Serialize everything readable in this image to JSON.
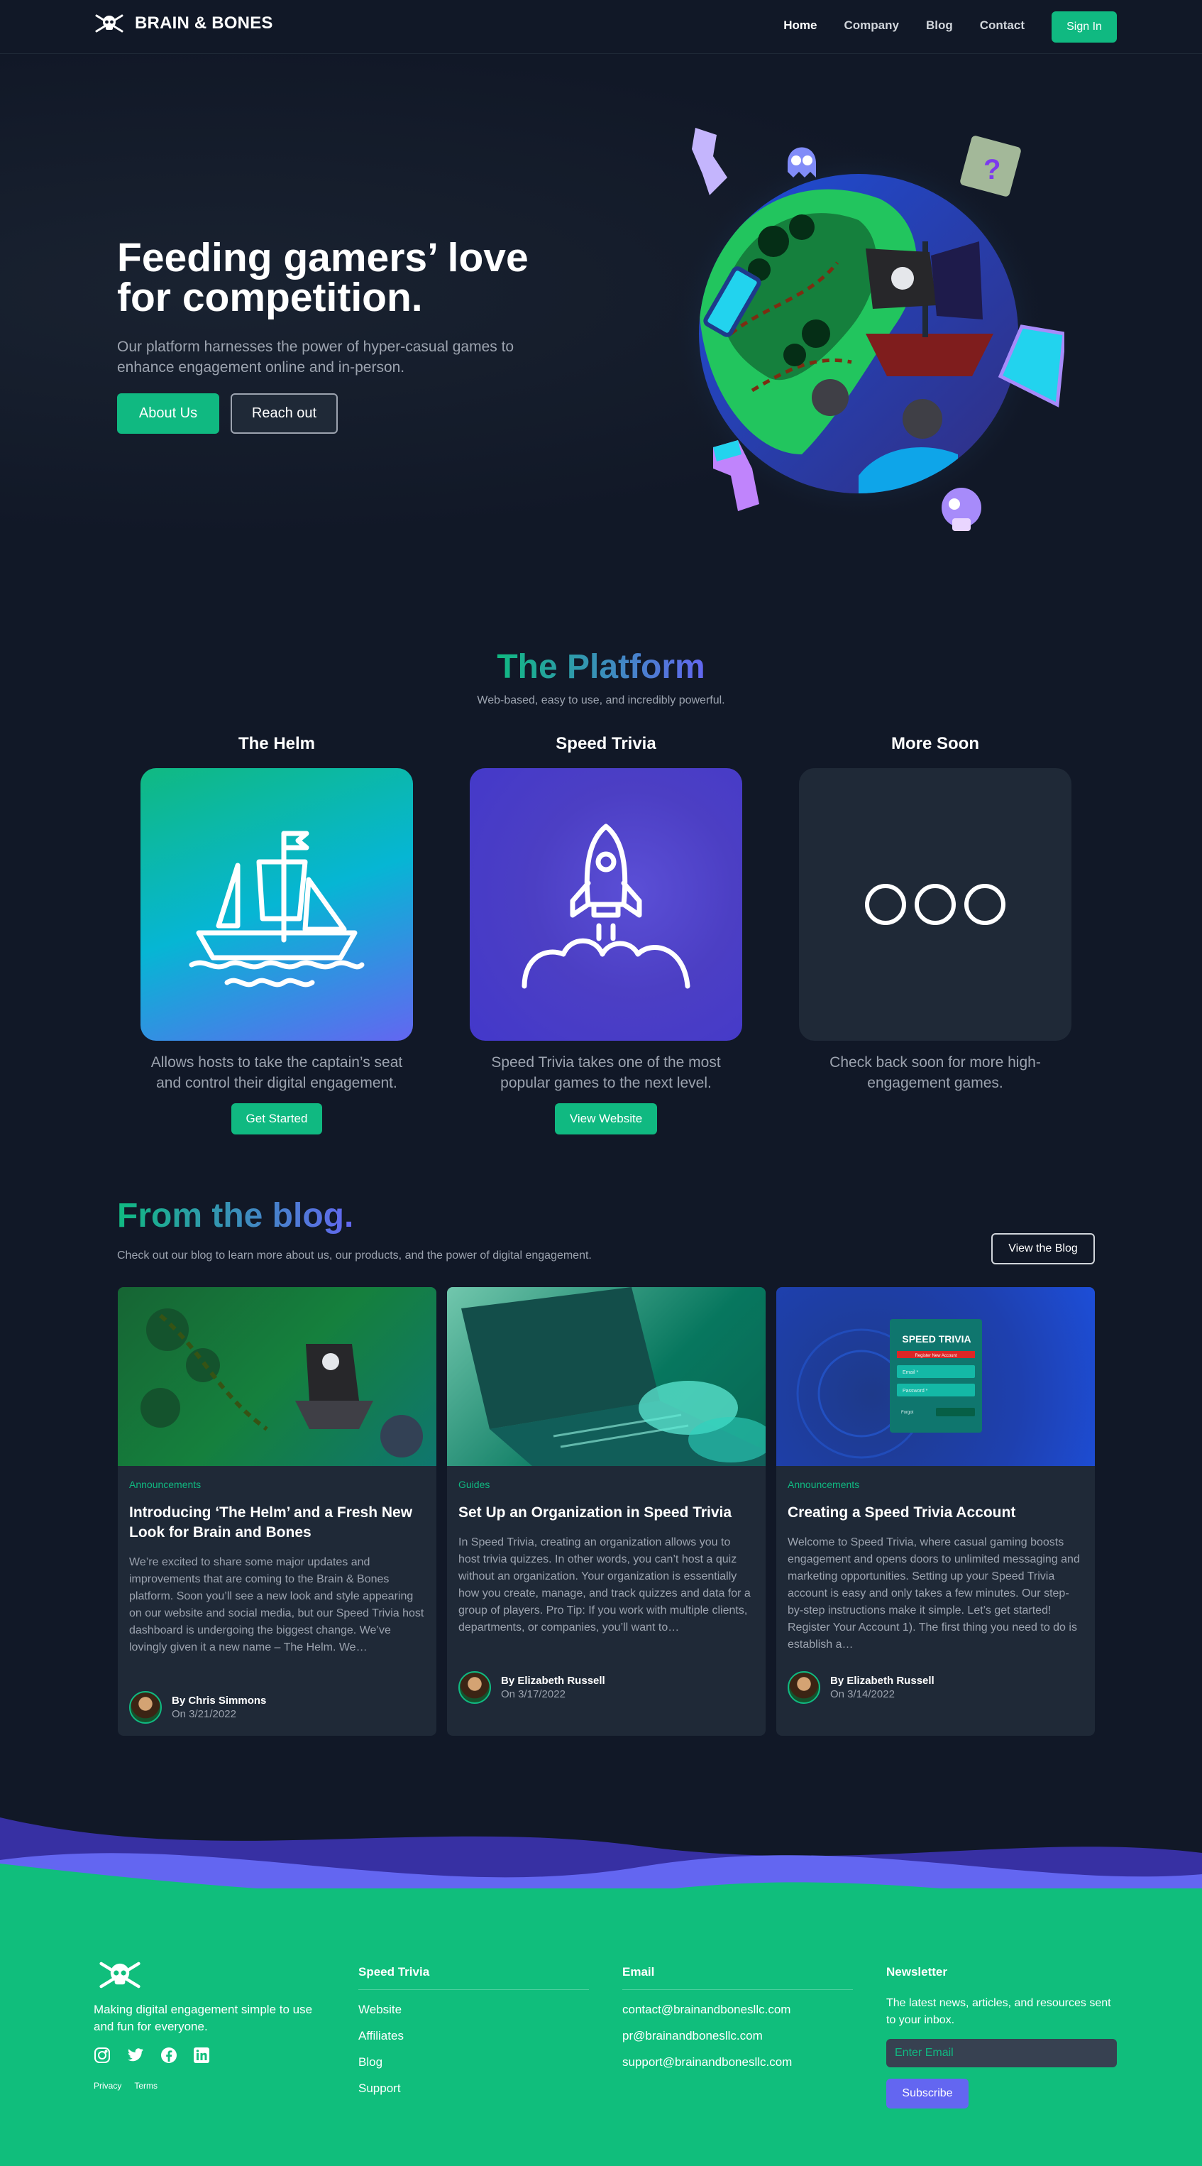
{
  "nav": {
    "brand": "BRAIN & BONES",
    "links": [
      "Home",
      "Company",
      "Blog",
      "Contact"
    ],
    "signin": "Sign In"
  },
  "hero": {
    "title": "Feeding gamers’ love for competition.",
    "subtitle": "Our platform harnesses the power of hyper-casual games to enhance engagement online and in-person.",
    "primary_button": "About Us",
    "secondary_button": "Reach out"
  },
  "platform": {
    "title": "The Platform",
    "subtitle": "Web-based, easy to use, and incredibly powerful.",
    "cards": [
      {
        "title": "The Helm",
        "desc": "Allows hosts to take the captain’s seat and control their digital engagement.",
        "button": "Get Started",
        "icon": "ship-icon"
      },
      {
        "title": "Speed Trivia",
        "desc": "Speed Trivia takes one of the most popular games to the next level.",
        "button": "View Website",
        "icon": "rocket-icon"
      },
      {
        "title": "More Soon",
        "desc": "Check back soon for more high-engagement games.",
        "button": "",
        "icon": "three-circles-icon"
      }
    ]
  },
  "blog": {
    "title": "From the blog.",
    "subtitle": "Check out our blog to learn more about us, our products, and the power of digital engagement.",
    "view_button": "View the Blog",
    "posts": [
      {
        "category": "Announcements",
        "title": "Introducing ‘The Helm’ and a Fresh New Look for Brain and Bones",
        "excerpt": "We’re excited to share some major updates and improvements that are coming to the Brain & Bones platform. Soon you’ll see a new look and style appearing on our website and social media, but our Speed Trivia host dashboard is undergoing the biggest change. We’ve lovingly given it a new name – The Helm. We…",
        "author": "By Chris Simmons",
        "date": "On 3/21/2022"
      },
      {
        "category": "Guides",
        "title": "Set Up an Organization in Speed Trivia",
        "excerpt": "In Speed Trivia, creating an organization allows you to host trivia quizzes. In other words, you can’t host a quiz without an organization. Your organization is essentially how you create, manage, and track quizzes and data for a group of players.  Pro Tip: If you work with multiple clients, departments, or companies, you’ll want to…",
        "author": "By Elizabeth Russell",
        "date": "On 3/17/2022"
      },
      {
        "category": "Announcements",
        "title": "Creating a Speed Trivia Account",
        "excerpt": "Welcome to Speed Trivia, where casual gaming boosts engagement and opens doors to unlimited messaging and marketing opportunities. Setting up your Speed Trivia account is easy and only takes a few minutes. Our step-by-step instructions make it simple. Let’s get started! Register Your Account 1). The first thing you need to do is establish a…",
        "author": "By Elizabeth Russell",
        "date": "On 3/14/2022"
      }
    ],
    "post3_image_text": {
      "brand": "SPEED TRIVIA",
      "bar": "Register New Account",
      "email": "Email *",
      "password": "Password *",
      "action": "Forgot"
    }
  },
  "footer": {
    "tagline": "Making digital engagement simple to use and fun for everyone.",
    "legal": [
      "Privacy",
      "Terms"
    ],
    "social_icons": [
      "instagram-icon",
      "twitter-icon",
      "facebook-icon",
      "linkedin-icon"
    ],
    "col1": {
      "title": "Speed Trivia",
      "links": [
        "Website",
        "Affiliates",
        "Blog",
        "Support"
      ]
    },
    "col2": {
      "title": "Email",
      "links": [
        "contact@brainandbonesllc.com",
        "pr@brainandbonesllc.com",
        "support@brainandbonesllc.com"
      ]
    },
    "newsletter": {
      "title": "Newsletter",
      "text": "The latest news, articles, and resources sent to your inbox.",
      "placeholder": "Enter Email",
      "button": "Subscribe"
    }
  },
  "colors": {
    "accent": "#10b981",
    "indigo": "#6366f1",
    "bg": "#111827",
    "card": "#1f2937"
  }
}
